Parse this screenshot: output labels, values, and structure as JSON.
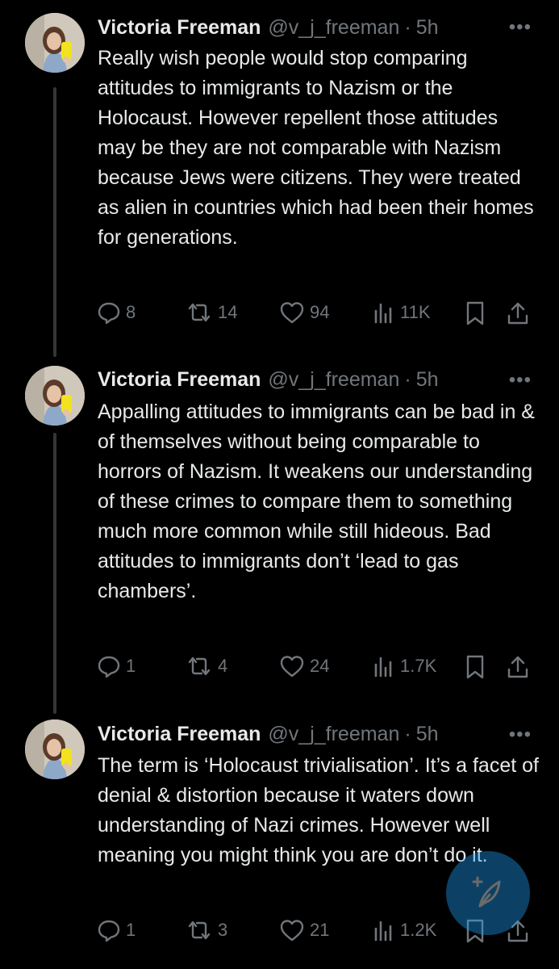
{
  "tweets": [
    {
      "name": "Victoria Freeman",
      "handle": "@v_j_freeman",
      "separator": "·",
      "time": "5h",
      "text": "Really wish people would stop comparing attitudes to immigrants to Nazism or the Holocaust. However repellent those attitudes may be they are not comparable with Nazism because Jews were citizens. They were treated as alien in countries which had been their homes for generations.",
      "replies": "8",
      "reposts": "14",
      "likes": "94",
      "views": "11K"
    },
    {
      "name": "Victoria Freeman",
      "handle": "@v_j_freeman",
      "separator": "·",
      "time": "5h",
      "text": "Appalling attitudes to immigrants can be bad in & of themselves without being comparable to horrors of Nazism. It weakens our understanding of these crimes to compare them to something much more common while still hideous. Bad attitudes to immigrants don’t ‘lead to gas chambers’.",
      "replies": "1",
      "reposts": "4",
      "likes": "24",
      "views": "1.7K"
    },
    {
      "name": "Victoria Freeman",
      "handle": "@v_j_freeman",
      "separator": "·",
      "time": "5h",
      "text": "The term is ‘Holocaust trivialisation’. It’s a facet of denial & distortion because it waters down understanding of Nazi crimes. However well meaning you might think you are don’t do it.",
      "replies": "1",
      "reposts": "3",
      "likes": "21",
      "views": "1.2K"
    }
  ],
  "more_label": "•••",
  "icons": {
    "reply": "reply-icon",
    "repost": "repost-icon",
    "like": "heart-icon",
    "views": "views-icon",
    "bookmark": "bookmark-icon",
    "share": "share-icon",
    "compose": "compose-post-icon"
  },
  "colors": {
    "background": "#000000",
    "text": "#e7e9ea",
    "muted": "#71767b",
    "accent": "#1d9bf0"
  }
}
